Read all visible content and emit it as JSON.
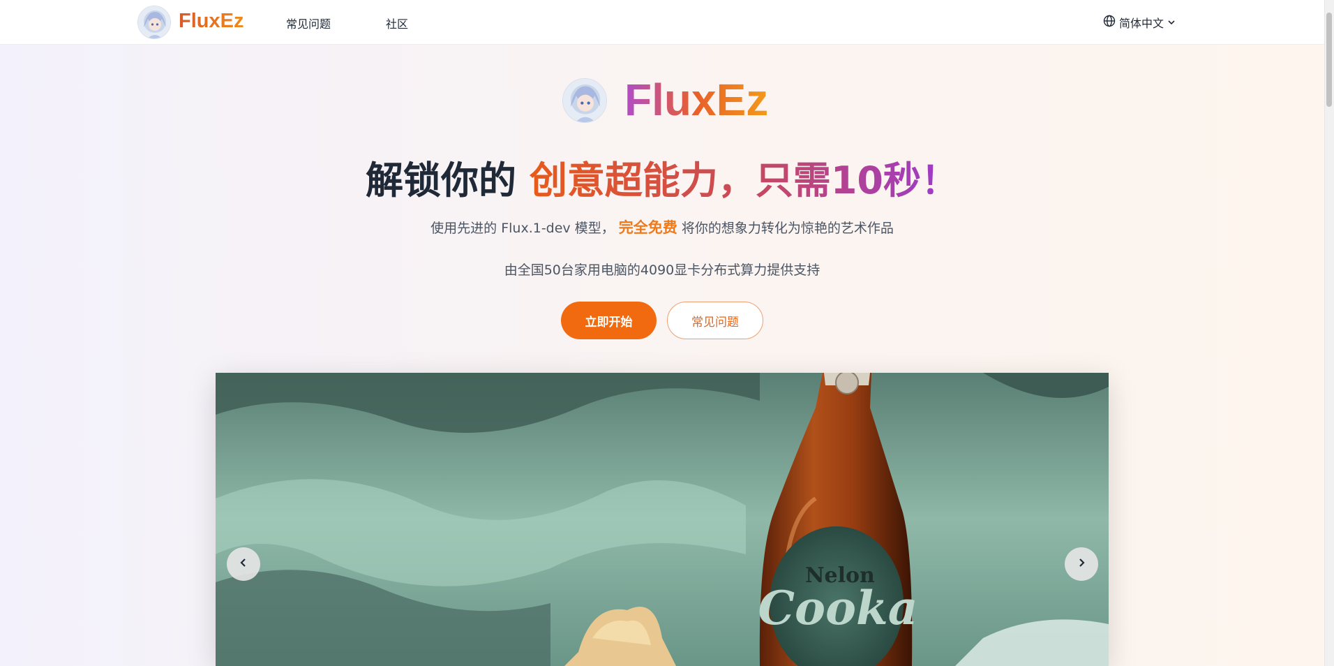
{
  "nav": {
    "brand": "FluxEz",
    "links": [
      "常见问题",
      "社区"
    ],
    "language": "简体中文"
  },
  "hero": {
    "brand": "FluxEz",
    "headline_plain": "解锁你的",
    "headline_gradient": "创意超能力，只需10秒！",
    "subtitle_before": "使用先进的 Flux.1-dev 模型，",
    "subtitle_highlight": "完全免费",
    "subtitle_after": "将你的想象力转化为惊艳的艺术作品",
    "support": "由全国50台家用电脑的4090显卡分布式算力提供支持",
    "btn_start": "立即开始",
    "btn_faq": "常见问题"
  },
  "carousel": {
    "label_top": "Nelon",
    "label_main": "Cooka",
    "cap_text": "Cooka"
  },
  "icons": {
    "globe": "globe-icon",
    "chevron": "chevron-down-icon",
    "prev": "chevron-left-icon",
    "next": "chevron-right-icon"
  },
  "colors": {
    "accent": "#f26a10",
    "brand_start": "#b04cc9",
    "brand_end": "#f39a1a"
  }
}
